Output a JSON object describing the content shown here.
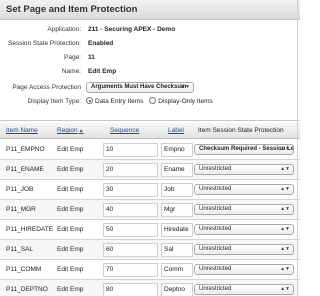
{
  "region": {
    "title": "Set Page and Item Protection"
  },
  "form": {
    "application": {
      "label": "Application:",
      "value": "211 - Securing APEX - Demo"
    },
    "session_state": {
      "label": "Session State Protection:",
      "value": "Enabled"
    },
    "page": {
      "label": "Page:",
      "value": "11"
    },
    "name": {
      "label": "Name:",
      "value": "Edit Emp"
    },
    "page_access": {
      "label": "Page Access Protection",
      "value": "Arguments Must Have Checksum"
    },
    "display_item_type": {
      "label": "Display Item Type:",
      "options": [
        {
          "label": "Data Entry Items",
          "selected": true
        },
        {
          "label": "Display-Only Items",
          "selected": false
        }
      ]
    }
  },
  "table": {
    "headers": {
      "item_name": "Item Name",
      "region": "Region",
      "sequence": "Sequence",
      "label": "Label",
      "protection": "Item Session State Protection"
    },
    "rows": [
      {
        "item_name": "P11_EMPNO",
        "region": "Edit Emp",
        "sequence": "10",
        "label": "Empno",
        "protection": "Checksum Required - Session Level",
        "protection_bold": true
      },
      {
        "item_name": "P11_ENAME",
        "region": "Edit Emp",
        "sequence": "20",
        "label": "Ename",
        "protection": "Unrestricted"
      },
      {
        "item_name": "P11_JOB",
        "region": "Edit Emp",
        "sequence": "30",
        "label": "Job",
        "protection": "Unrestricted"
      },
      {
        "item_name": "P11_MGR",
        "region": "Edit Emp",
        "sequence": "40",
        "label": "Mgr",
        "protection": "Unrestricted"
      },
      {
        "item_name": "P11_HIREDATE",
        "region": "Edit Emp",
        "sequence": "50",
        "label": "Hiredate",
        "protection": "Unrestricted"
      },
      {
        "item_name": "P11_SAL",
        "region": "Edit Emp",
        "sequence": "60",
        "label": "Sal",
        "protection": "Unrestricted"
      },
      {
        "item_name": "P11_COMM",
        "region": "Edit Emp",
        "sequence": "70",
        "label": "Comm",
        "protection": "Unrestricted"
      },
      {
        "item_name": "P11_DEPTNO",
        "region": "Edit Emp",
        "sequence": "80",
        "label": "Deptno",
        "protection": "Unrestricted"
      }
    ]
  }
}
